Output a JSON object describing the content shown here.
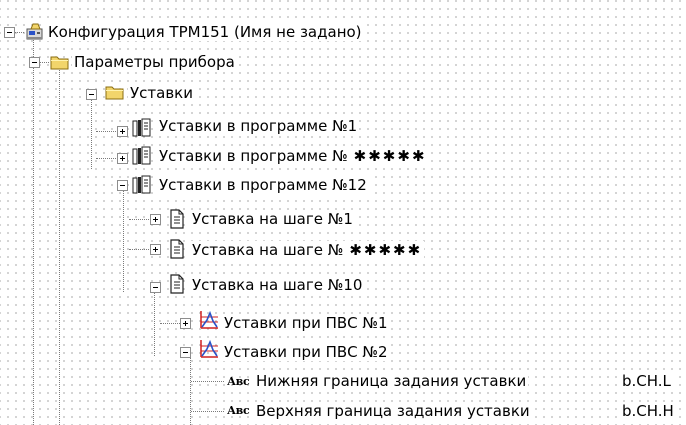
{
  "tree": {
    "root": {
      "label": "Конфигурация ТРМ151 (Имя не задано)",
      "icon": "device-config-icon"
    },
    "device_params": {
      "label": "Параметры прибора",
      "icon": "folder-icon"
    },
    "setpoints": {
      "label": "Уставки",
      "icon": "folder-icon"
    },
    "program_1": {
      "label": "Уставки в программе №1",
      "icon": "book-icon"
    },
    "program_n": {
      "label": "Уставки в программе №",
      "stars": "✱✱✱✱✱",
      "icon": "book-icon"
    },
    "program_12": {
      "label": "Уставки в программе №12",
      "icon": "book-icon"
    },
    "step_1": {
      "label": "Уставка на шаге №1",
      "icon": "document-icon"
    },
    "step_n": {
      "label": "Уставка на шаге №",
      "stars": "✱✱✱✱✱",
      "icon": "document-icon"
    },
    "step_10": {
      "label": "Уставка на шаге №10",
      "icon": "document-icon"
    },
    "pvs_1": {
      "label": "Уставки при ПВС №1",
      "icon": "chart-icon"
    },
    "pvs_2": {
      "label": "Уставки при ПВС №2",
      "icon": "chart-icon"
    },
    "lower_bound": {
      "label": "Нижняя граница задания уставки",
      "value": "b.CH.L",
      "icon_text": "Авс"
    },
    "upper_bound": {
      "label": "Верхняя граница задания уставки",
      "value": "b.CH.H",
      "icon_text": "Авс"
    }
  },
  "colors": {
    "folder": "#f2d56b",
    "chart_red": "#d02020",
    "chart_blue": "#2a52c8",
    "connector": "#7a7a7a"
  }
}
